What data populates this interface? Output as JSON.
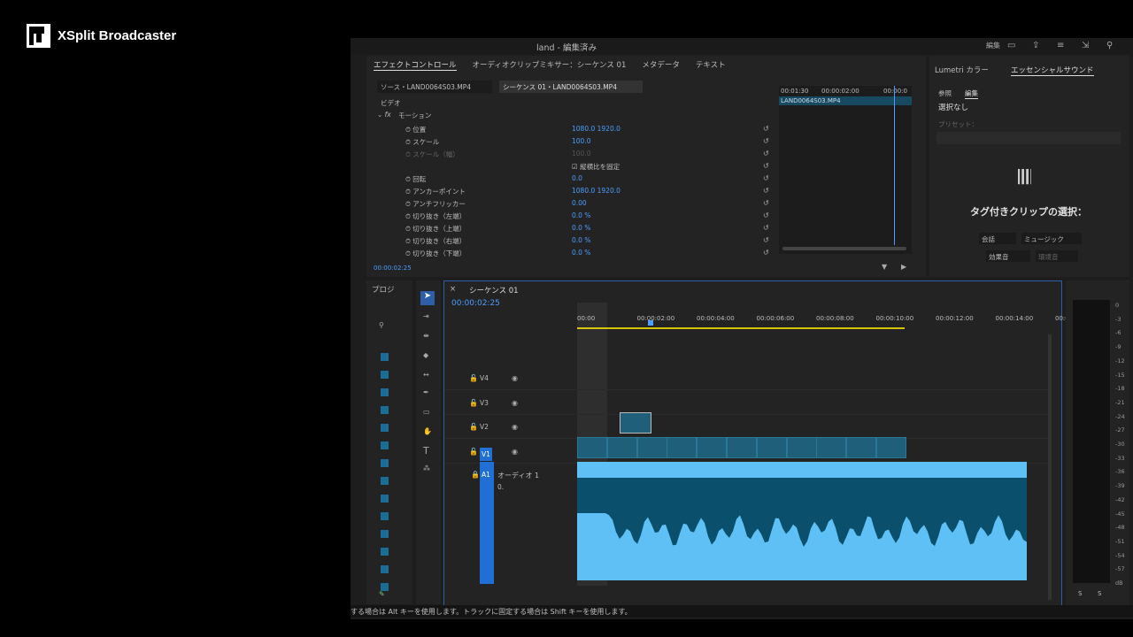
{
  "overlay": {
    "brand": "XSplit Broadcaster"
  },
  "app": {
    "title": "land - 編集済み",
    "header_right_label": "編集"
  },
  "effect_controls": {
    "tabs": [
      "エフェクトコントロール",
      "オーディオクリップミキサー：シーケンス 01",
      "メタデータ",
      "テキスト"
    ],
    "source_tab": "ソース・LAND0064S03.MP4",
    "sequence_tab": "シーケンス 01・LAND0064S03.MP4",
    "section_video": "ビデオ",
    "section_motion": "モーション",
    "properties": [
      {
        "name": "位置",
        "value": "1080.0   1920.0"
      },
      {
        "name": "スケール",
        "value": "100.0"
      },
      {
        "name": "スケール（幅）",
        "value": "100.0"
      },
      {
        "name": "縦横比を固定",
        "value": ""
      },
      {
        "name": "回転",
        "value": "0.0"
      },
      {
        "name": "アンカーポイント",
        "value": "1080.0   1920.0"
      },
      {
        "name": "アンチフリッカー",
        "value": "0.00"
      },
      {
        "name": "切り抜き（左端）",
        "value": "0.0 %"
      },
      {
        "name": "切り抜き（上端）",
        "value": "0.0 %"
      },
      {
        "name": "切り抜き（右端）",
        "value": "0.0 %"
      },
      {
        "name": "切り抜き（下端）",
        "value": "0.0 %"
      }
    ],
    "mini_timecode_a": "00:01:30",
    "mini_timecode_b": "00:00:02:00",
    "mini_timecode_c": "00:00:0",
    "mini_clip": "LAND0064S03.MP4",
    "current_time": "00:00:02:25"
  },
  "essential_sound": {
    "tab_lumetri": "Lumetri カラー",
    "tab_essential": "エッセンシャルサウンド",
    "sub_browse": "参照",
    "sub_edit": "編集",
    "selection": "選択なし",
    "preset_label": "プリセット：",
    "prompt": "タグ付きクリップの選択：",
    "btn_dialogue": "会話",
    "btn_music": "ミュージック",
    "btn_sfx": "効果音",
    "btn_ambience": "環境音"
  },
  "project": {
    "tab": "プロジ"
  },
  "timeline": {
    "sequence_name": "シーケンス 01",
    "timecode": "00:00:02:25",
    "ruler": [
      "00:00",
      "00:00:02:00",
      "00:00:04:00",
      "00:00:06:00",
      "00:00:08:00",
      "00:00:10:00",
      "00:00:12:00",
      "00:00:14:00",
      "00:0"
    ],
    "tracks": [
      "V4",
      "V3",
      "V2",
      "V1"
    ],
    "audio_track": "A1",
    "audio_track_name": "オーディオ 1",
    "audio_vol": "0."
  },
  "meter": {
    "labels": [
      "0",
      "-3",
      "-6",
      "-9",
      "-12",
      "-15",
      "-18",
      "-21",
      "-24",
      "-27",
      "-30",
      "-33",
      "-36",
      "-39",
      "-42",
      "-45",
      "-48",
      "-51",
      "-54",
      "-57",
      "dB"
    ],
    "solo": "S"
  },
  "status": {
    "text": "する場合は Alt キーを使用します。トラックに固定する場合は Shift キーを使用します。"
  },
  "colors": {
    "accent": "#4a9eff",
    "clip": "#1f5f7a",
    "audio": "#5ec0f5",
    "audio_dark": "#0a4f6b"
  }
}
